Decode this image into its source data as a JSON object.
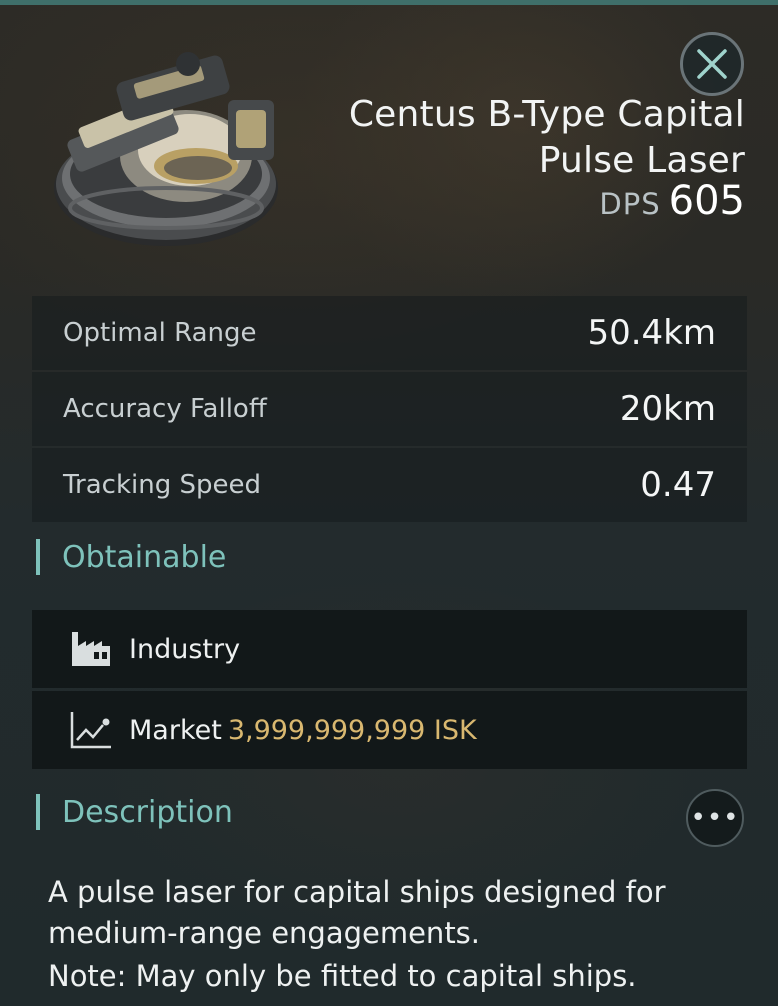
{
  "item": {
    "name": "Centus B-Type Capital Pulse Laser",
    "dps_label": "DPS",
    "dps_value": "605"
  },
  "stats": [
    {
      "label": "Optimal Range",
      "value": "50.4km"
    },
    {
      "label": "Accuracy Falloff",
      "value": "20km"
    },
    {
      "label": "Tracking Speed",
      "value": "0.47"
    }
  ],
  "obtainable": {
    "title": "Obtainable",
    "industry_label": "Industry",
    "market_label": "Market",
    "market_price": "3,999,999,999 ISK"
  },
  "description": {
    "title": "Description",
    "text": "A pulse laser for capital ships designed for medium-range engagements.",
    "note": "Note: May only be fitted to capital ships."
  },
  "colors": {
    "accent": "#7ec2bb",
    "price": "#d9b870",
    "row_bg": "#121819"
  },
  "icons": {
    "close": "close-icon",
    "industry": "factory-icon",
    "market": "market-chart-icon",
    "more": "more-options-icon"
  }
}
